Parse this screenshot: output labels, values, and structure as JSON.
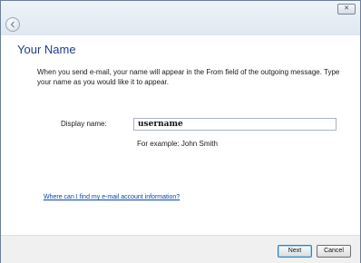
{
  "window": {
    "close_glyph": "✕"
  },
  "icons": {
    "back": "back-arrow-icon",
    "close": "close-icon"
  },
  "page": {
    "title": "Your Name",
    "description": "When you send e-mail, your name will appear in the From field of the outgoing message. Type your name as you would like it to appear.",
    "display_name_label": "Display name:",
    "display_name_value": "username",
    "example_text": "For example: John Smith",
    "help_link": "Where can I find my e-mail account information?"
  },
  "buttons": {
    "next": "Next",
    "cancel": "Cancel"
  },
  "colors": {
    "title": "#1e3f8a",
    "link": "#0645ad",
    "footer_bg": "#f0f0f0"
  }
}
